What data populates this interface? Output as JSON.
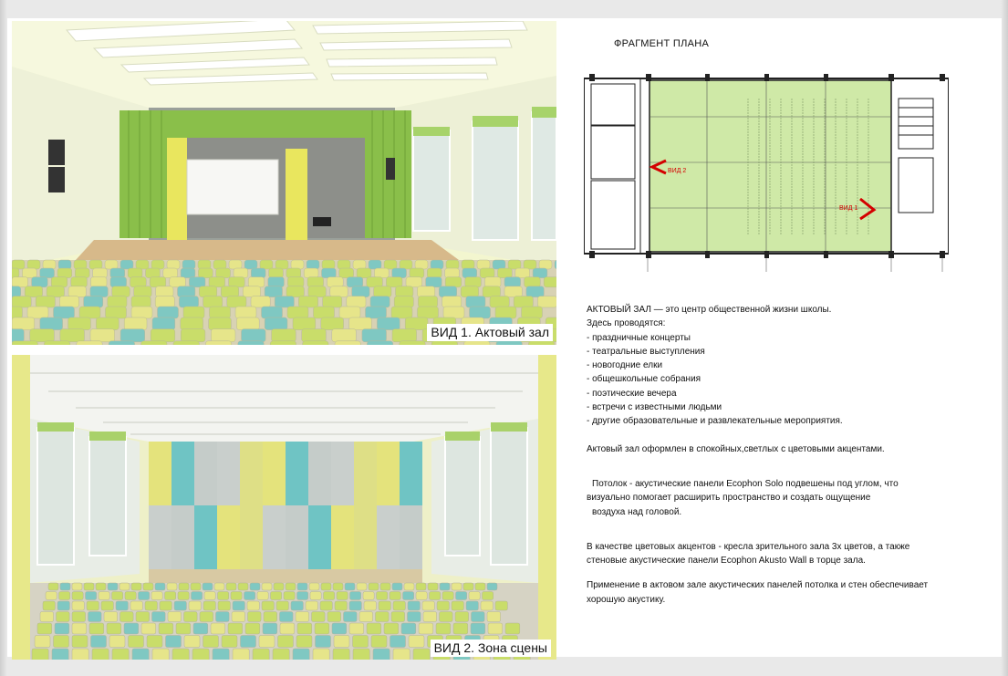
{
  "views": [
    {
      "caption": "ВИД 1. Актовый зал"
    },
    {
      "caption": "ВИД 2. Зона сцены"
    }
  ],
  "plan": {
    "title": "ФРАГМЕНТ ПЛАНА",
    "marker_1": "ВИД 1",
    "marker_2": "ВИД 2",
    "marker_color": "#d40000",
    "hall_fill": "#cfe9a7"
  },
  "description": {
    "intro": "АКТОВЫЙ ЗАЛ — это центр общественной жизни школы.",
    "lead": "Здесь проводятся:",
    "bullets": [
      "- праздничные концерты",
      "- театральные выступления",
      "- новогодние елки",
      "- общешкольные собрания",
      "- поэтические вечера",
      "- встречи с известными людьми",
      "- другие образовательные и развлекательные мероприятия."
    ],
    "p_design": "Актовый зал оформлен в спокойных,светлых с цветовыми акцентами.",
    "p_ceiling_1": "Потолок - акустические панели Ecophon Solo подвешены под углом, что",
    "p_ceiling_2": "визуально помогает расширить пространство и создать ощущение",
    "p_ceiling_3": "воздуха над головой.",
    "p_accents_1": "В качестве цветовых акцентов - кресла зрительного зала 3х цветов, а также",
    "p_accents_2": "стеновые акустические панели Ecophon Akusto Wall в торце зала.",
    "p_acoustics_1": "Применение в актовом зале акустических панелей потолка и стен обеспечивает",
    "p_acoustics_2": "хорошую акустику."
  },
  "colors": {
    "seat_green": "#c9dd6a",
    "seat_teal": "#7fc8c2",
    "seat_yellow": "#e6e58a",
    "curtain_green": "#7fb23f",
    "curtain_yellow": "#e8e85a"
  }
}
